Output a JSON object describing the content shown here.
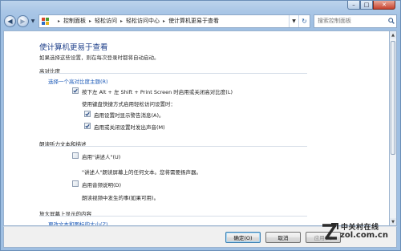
{
  "window": {
    "caption_buttons": [
      "minimize-icon",
      "maximize-icon",
      "close-icon"
    ],
    "accent_color": "#a9c6e6"
  },
  "navbar": {
    "breadcrumbs": [
      "控制面板",
      "轻松访问",
      "轻松访问中心",
      "使计算机更易于查看"
    ],
    "search_placeholder": "搜索控制面板"
  },
  "main": {
    "title": "使计算机更易于查看",
    "subtitle": "如果选择这些设置，则在每次登录时都将自动启动。",
    "high_contrast": {
      "heading": "高对比度",
      "theme_link": "选择一个高对比度主题(R)",
      "toggle_label": "按下左 Alt + 左 Shift + Print Screen 时启用或关闭高对比度(L)",
      "toggle_checked": true,
      "shortcut_caption": "使用键盘快捷方式启用轻松访问设置时：",
      "warning_label": "启用设置时显示警告消息(A)。",
      "warning_checked": true,
      "sound_label": "启用或关闭设置时发出声音(M)",
      "sound_checked": true
    },
    "narration": {
      "heading": "朗读听力文本和描述",
      "narrator_label": "启用\"讲述人\"(U)",
      "narrator_checked": false,
      "narrator_desc": "\"讲述人\"朗读屏幕上的任何文本。您将需要扬声器。",
      "audio_desc_label": "启用音频说明(D)",
      "audio_desc_checked": false,
      "audio_desc_desc": "朗读视频中发生的事(如果可用)。"
    },
    "magnify": {
      "heading": "放大屏幕上显示的内容",
      "text_size_link": "更改文本和图标的大小(Z)"
    }
  },
  "buttons": {
    "ok": "确定(O)",
    "cancel": "取消",
    "apply": "应用(A)"
  },
  "watermark": {
    "cn": "中关村在线",
    "en": "zol.com.cn"
  }
}
